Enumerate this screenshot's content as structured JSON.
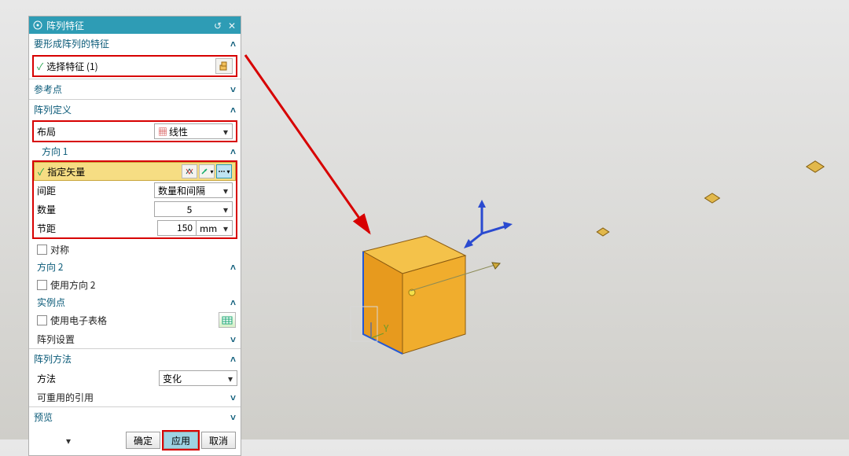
{
  "titlebar": {
    "title": "阵列特征"
  },
  "sections": {
    "features": {
      "title": "要形成阵列的特征",
      "select_feature": "选择特征 (1)"
    },
    "refpoint": {
      "title": "参考点"
    },
    "patterndef": {
      "title": "阵列定义",
      "layout_lbl": "布局",
      "layout_val": "线性",
      "dir1": {
        "title": "方向 1",
        "specify_vector": "指定矢量",
        "spacing_lbl": "间距",
        "spacing_val": "数量和间隔",
        "count_lbl": "数量",
        "count_val": "5",
        "pitch_lbl": "节距",
        "pitch_val": "150",
        "pitch_unit": "mm",
        "symmetric": "对称"
      },
      "dir2": {
        "title": "方向 2",
        "use_dir2": "使用方向 2"
      },
      "instpts": {
        "title": "实例点",
        "use_sheet": "使用电子表格"
      },
      "settings": {
        "title": "阵列设置"
      }
    },
    "method": {
      "title": "阵列方法",
      "method_lbl": "方法",
      "method_val": "变化",
      "reusable": "可重用的引用"
    },
    "preview": {
      "title": "预览"
    }
  },
  "buttons": {
    "ok": "确定",
    "apply": "应用",
    "cancel": "取消"
  }
}
